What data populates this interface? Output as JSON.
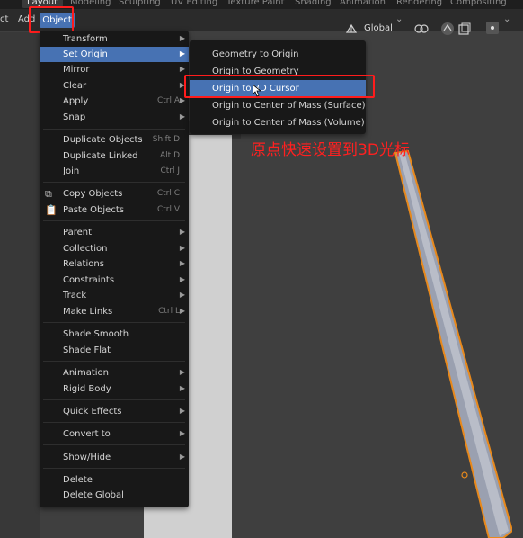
{
  "workspace_tabs": [
    "Layout",
    "Modeling",
    "Sculpting",
    "UV Editing",
    "Texture Paint",
    "Shading",
    "Animation",
    "Rendering",
    "Compositing"
  ],
  "header": {
    "select_label": "ct",
    "add_label": "Add",
    "object_label": "Object",
    "transform_orientation": "Global"
  },
  "menu": {
    "items": [
      {
        "label": "Transform",
        "shortcut": "",
        "submenu": true
      },
      {
        "label": "Set Origin",
        "shortcut": "",
        "submenu": true
      },
      {
        "label": "Mirror",
        "shortcut": "",
        "submenu": true
      },
      {
        "label": "Clear",
        "shortcut": "",
        "submenu": true
      },
      {
        "label": "Apply",
        "shortcut": "Ctrl A",
        "submenu": true
      },
      {
        "label": "Snap",
        "shortcut": "",
        "submenu": true
      },
      {
        "label": "Duplicate Objects",
        "shortcut": "Shift D",
        "submenu": false
      },
      {
        "label": "Duplicate Linked",
        "shortcut": "Alt D",
        "submenu": false
      },
      {
        "label": "Join",
        "shortcut": "Ctrl J",
        "submenu": false
      },
      {
        "label": "Copy Objects",
        "shortcut": "Ctrl C",
        "submenu": false
      },
      {
        "label": "Paste Objects",
        "shortcut": "Ctrl V",
        "submenu": false
      },
      {
        "label": "Parent",
        "shortcut": "",
        "submenu": true
      },
      {
        "label": "Collection",
        "shortcut": "",
        "submenu": true
      },
      {
        "label": "Relations",
        "shortcut": "",
        "submenu": true
      },
      {
        "label": "Constraints",
        "shortcut": "",
        "submenu": true
      },
      {
        "label": "Track",
        "shortcut": "",
        "submenu": true
      },
      {
        "label": "Make Links",
        "shortcut": "Ctrl L",
        "submenu": true
      },
      {
        "label": "Shade Smooth",
        "shortcut": "",
        "submenu": false
      },
      {
        "label": "Shade Flat",
        "shortcut": "",
        "submenu": false
      },
      {
        "label": "Animation",
        "shortcut": "",
        "submenu": true
      },
      {
        "label": "Rigid Body",
        "shortcut": "",
        "submenu": true
      },
      {
        "label": "Quick Effects",
        "shortcut": "",
        "submenu": true
      },
      {
        "label": "Convert to",
        "shortcut": "",
        "submenu": true
      },
      {
        "label": "Show/Hide",
        "shortcut": "",
        "submenu": true
      },
      {
        "label": "Delete",
        "shortcut": "",
        "submenu": false
      },
      {
        "label": "Delete Global",
        "shortcut": "",
        "submenu": false
      }
    ]
  },
  "set_origin_submenu": {
    "items": [
      {
        "label": "Geometry to Origin"
      },
      {
        "label": "Origin to Geometry"
      },
      {
        "label": "Origin to 3D Cursor"
      },
      {
        "label": "Origin to Center of Mass (Surface)"
      },
      {
        "label": "Origin to Center of Mass (Volume)"
      }
    ]
  },
  "annotation": "原点快速设置到3D光标",
  "colors": {
    "accent": "#4772b3",
    "highlight_box": "#ff1c1c",
    "annotation_text": "#ff2020",
    "rod_outline": "#e8891c"
  }
}
